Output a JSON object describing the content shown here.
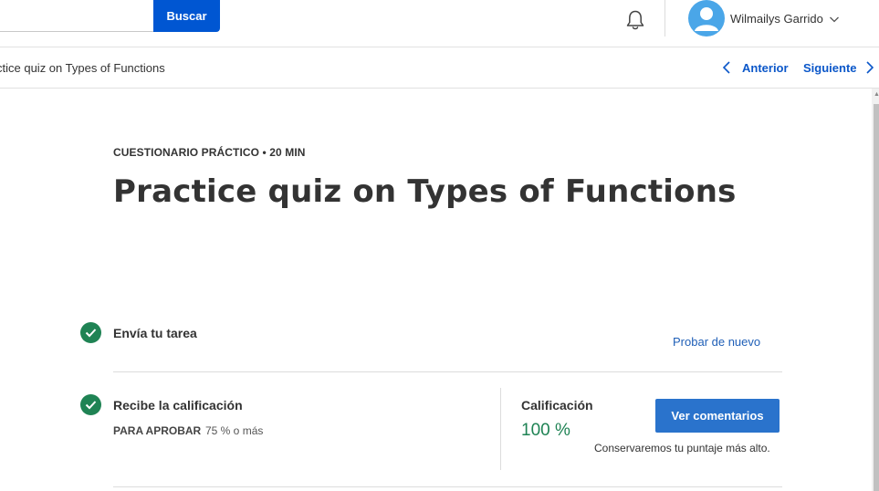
{
  "header": {
    "search": {
      "value": "",
      "button_label": "Buscar"
    },
    "user": {
      "name": "Wilmailys Garrido"
    }
  },
  "nav": {
    "breadcrumb": "ctice quiz on Types of Functions",
    "prev_label": "Anterior",
    "next_label": "Siguiente"
  },
  "main": {
    "eyebrow": "CUESTIONARIO PRÁCTICO • 20 MIN",
    "title": "Practice quiz on Types of Functions",
    "steps": [
      {
        "title": "Envía tu tarea",
        "action_label": "Probar de nuevo"
      },
      {
        "title": "Recibe la calificación",
        "pass_label": "PARA APROBAR",
        "pass_value": "75 % o más"
      }
    ],
    "grade": {
      "label": "Calificación",
      "value": "100 %",
      "button_label": "Ver comentarios",
      "note": "Conservaremos tu puntaje más alto."
    }
  },
  "colors": {
    "primary_blue": "#0056d2",
    "button_blue": "#2a73cc",
    "link_blue": "#1f5fb7",
    "success_green": "#1f8354",
    "avatar_blue": "#4aa6e8"
  },
  "icons": [
    "bell-icon",
    "user-avatar-icon",
    "chevron-down-icon",
    "chevron-left-icon",
    "chevron-right-icon",
    "checkmark-icon"
  ]
}
